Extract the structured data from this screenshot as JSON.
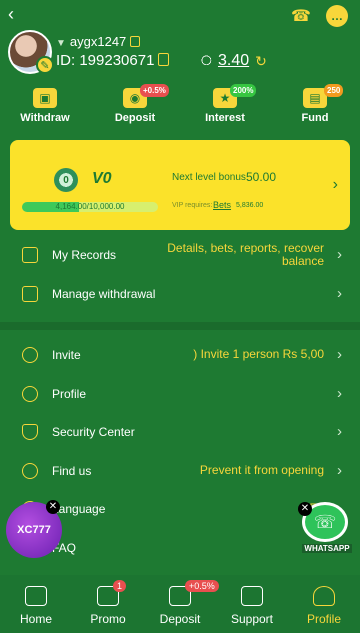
{
  "header": {
    "back_icon": "chevron-left",
    "support_icon": "headset",
    "more_icon": "ellipsis"
  },
  "profile": {
    "username": "aygx1247",
    "id_label": "ID:",
    "id_value": "199230671",
    "balance": "3.40",
    "currency_flag": "pakistan-flag-icon"
  },
  "actions": [
    {
      "label": "Withdraw",
      "badge": ""
    },
    {
      "label": "Deposit",
      "badge": "+0.5%"
    },
    {
      "label": "Interest",
      "badge": "200%"
    },
    {
      "label": "Fund",
      "badge": "250"
    }
  ],
  "vip": {
    "coin_text": "0",
    "level": "V0",
    "next_label": "Next level bonus",
    "next_value": "50.00",
    "progress_text": "4,164.00/10,000.00",
    "progress_fraction": 0.4164,
    "req_label": "VIP requires:",
    "req_link": "Bets",
    "req_value": "5,836.00"
  },
  "menu1": [
    {
      "label": "My Records",
      "value": "Details, bets, reports, recover balance"
    },
    {
      "label": "Manage withdrawal",
      "value": ""
    }
  ],
  "menu2": [
    {
      "label": "Invite",
      "value": ") Invite 1 person Rs 5,00"
    },
    {
      "label": "Profile",
      "value": ""
    },
    {
      "label": "Security Center",
      "value": ""
    },
    {
      "label": "Find us",
      "value": "Prevent it from opening"
    },
    {
      "label": "Language",
      "value": "En"
    },
    {
      "label": "FAQ",
      "value": ""
    }
  ],
  "floating": {
    "left_text": "XC777",
    "right_text": "WHATSAPP"
  },
  "bottom_nav": [
    {
      "label": "Home",
      "badge": ""
    },
    {
      "label": "Promo",
      "badge": "1"
    },
    {
      "label": "Deposit",
      "badge": "+0.5%"
    },
    {
      "label": "Support",
      "badge": ""
    },
    {
      "label": "Profile",
      "badge": ""
    }
  ],
  "colors": {
    "bg": "#1e7a32",
    "accent": "#f7d63b",
    "card": "#fbe22a",
    "badge_red": "#e84f4f"
  }
}
